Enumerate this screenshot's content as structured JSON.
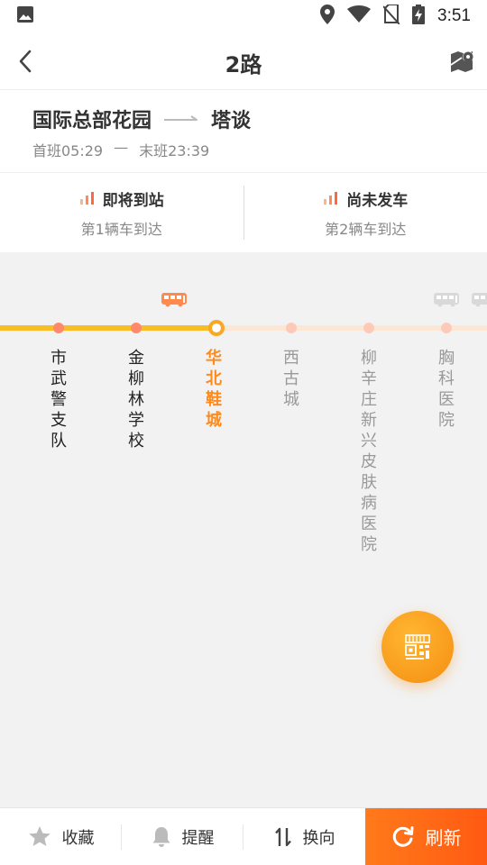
{
  "status_bar": {
    "time": "3:51",
    "left_icon": "image-icon",
    "right_icons": [
      "location-icon",
      "wifi-icon",
      "no-sim-icon",
      "battery-charging-icon"
    ]
  },
  "header": {
    "back_icon": "chevron-left-icon",
    "title": "2路",
    "map_icon": "map-pin-icon"
  },
  "route": {
    "from": "国际总部花园",
    "to": "塔谈",
    "first_bus": "首班05:29",
    "separator": "—",
    "last_bus": "末班23:39"
  },
  "arrivals": [
    {
      "status": "即将到站",
      "sub": "第1辆车到达"
    },
    {
      "status": "尚未发车",
      "sub": "第2辆车到达"
    }
  ],
  "stations": [
    {
      "name": "市武警支队",
      "state": "passed"
    },
    {
      "name": "金柳林学校",
      "state": "passed"
    },
    {
      "name": "华北鞋城",
      "state": "current"
    },
    {
      "name": "西古城",
      "state": "future"
    },
    {
      "name": "柳辛庄新兴皮肤病医院",
      "state": "future"
    },
    {
      "name": "胸科医院",
      "state": "future"
    }
  ],
  "colors": {
    "accent_orange": "#ff8a1c",
    "track_passed": "#f9bd26",
    "track_ahead": "#fbe7d4",
    "bus_active": "#ff8a4c",
    "bus_inactive": "#d9d9d9",
    "refresh_bg": "#ff6a16"
  },
  "fab": {
    "icon": "scan-code-icon"
  },
  "bottom_bar": {
    "favorite": {
      "label": "收藏",
      "icon": "star-icon"
    },
    "remind": {
      "label": "提醒",
      "icon": "bell-icon"
    },
    "reverse": {
      "label": "换向",
      "icon": "swap-icon"
    },
    "refresh": {
      "label": "刷新",
      "icon": "refresh-icon"
    }
  }
}
